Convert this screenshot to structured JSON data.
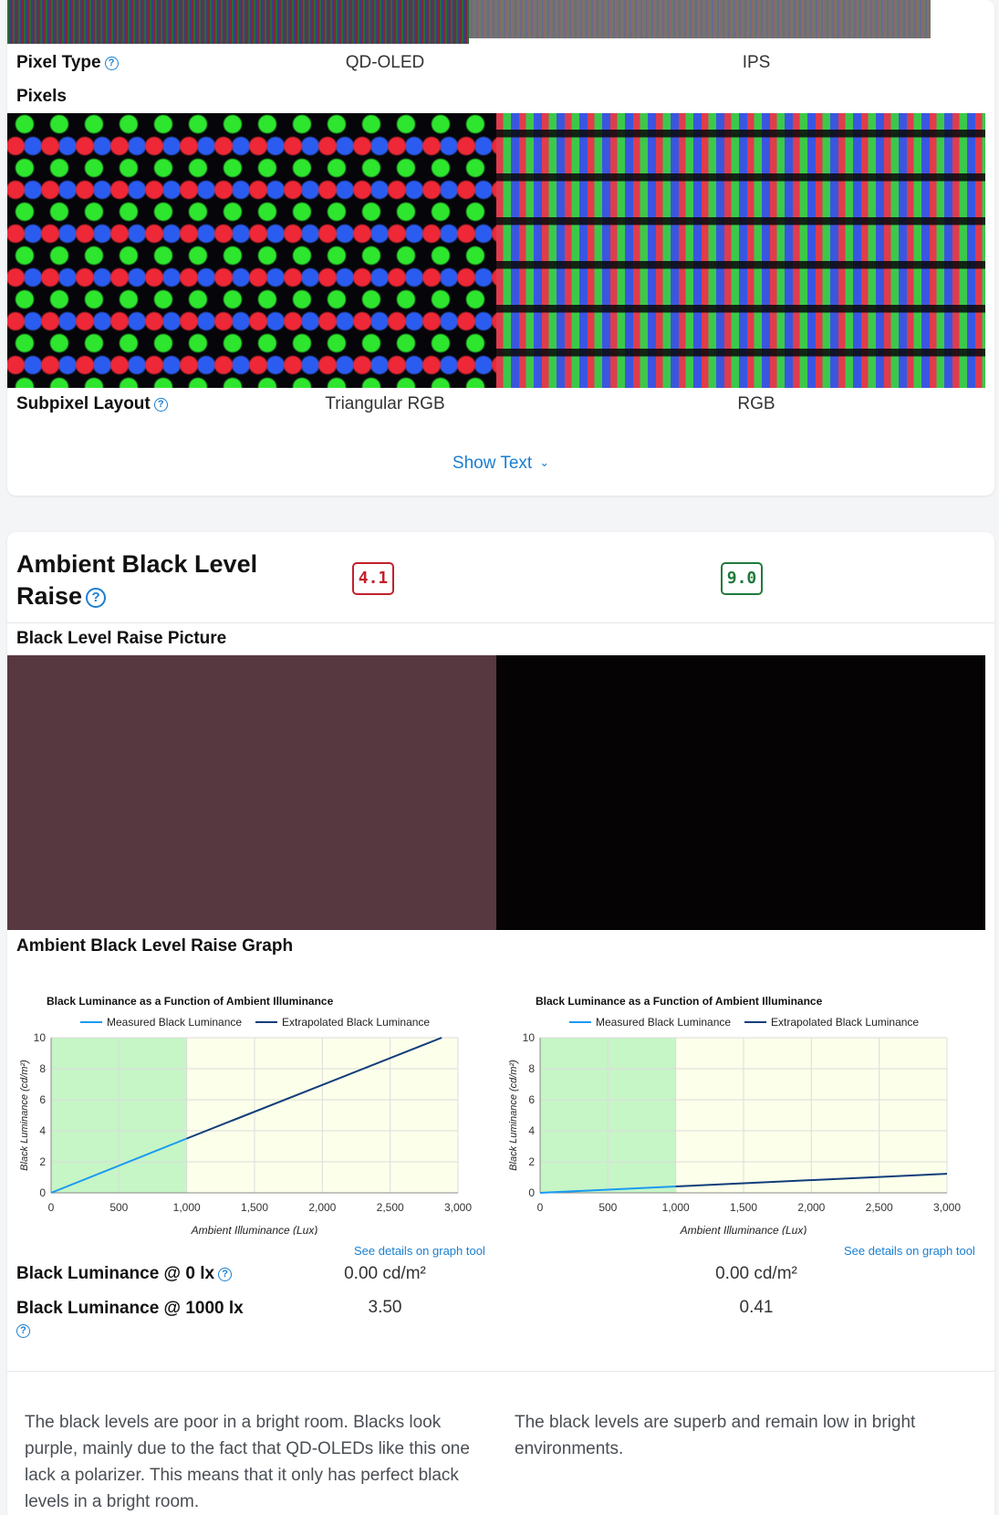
{
  "pixels_section": {
    "pixel_type": {
      "label": "Pixel Type",
      "left": "QD-OLED",
      "right": "IPS"
    },
    "pixels_label": "Pixels",
    "subpixel_layout": {
      "label": "Subpixel Layout",
      "left": "Triangular RGB",
      "right": "RGB"
    },
    "show_text": "Show Text"
  },
  "ambient_section": {
    "title": "Ambient Black Level Raise",
    "score_left": "4.1",
    "score_right": "9.0",
    "colors": {
      "poor": "#c3202b",
      "good": "#1f7a3a",
      "link": "#1a7fd1"
    },
    "picture_label": "Black Level Raise Picture",
    "picture_colors": {
      "left": "#583840",
      "right": "#060304"
    },
    "graph_label": "Ambient Black Level Raise Graph",
    "graph_link": "See details on graph tool",
    "black_at_0": {
      "label": "Black Luminance @ 0 lx",
      "left": "0.00 cd/m²",
      "right": "0.00 cd/m²"
    },
    "black_at_1000": {
      "label": "Black Luminance @ 1000 lx",
      "left": "3.50",
      "right": "0.41"
    },
    "desc_left": "The black levels are poor in a bright room. Blacks look purple, mainly due to the fact that QD-OLEDs like this one lack a polarizer. This means that it only has perfect black levels in a bright room.",
    "desc_right": "The black levels are superb and remain low in bright environments."
  },
  "chart_data": [
    {
      "type": "line",
      "title": "Black Luminance as a Function of Ambient Illuminance",
      "xlabel": "Ambient Illuminance (Lux)",
      "ylabel": "Black Luminance (cd/m²)",
      "xlim": [
        0,
        3000
      ],
      "ylim": [
        0,
        10
      ],
      "xticks": [
        "0",
        "500",
        "1,000",
        "1,500",
        "2,000",
        "2,500",
        "3,000"
      ],
      "yticks": [
        "0",
        "2",
        "4",
        "6",
        "8",
        "10"
      ],
      "shaded_region": {
        "range": [
          0,
          1000
        ],
        "color": "#c6f5c6"
      },
      "plot_background": "#fcffea",
      "grid": true,
      "legend_position": "top-center",
      "series": [
        {
          "name": "Measured Black Luminance",
          "color": "#1a9af0",
          "x": [
            0,
            1000
          ],
          "y": [
            0,
            3.5
          ]
        },
        {
          "name": "Extrapolated Black Luminance",
          "color": "#103d7a",
          "x": [
            1000,
            2880
          ],
          "y": [
            3.5,
            10
          ]
        }
      ]
    },
    {
      "type": "line",
      "title": "Black Luminance as a Function of Ambient Illuminance",
      "xlabel": "Ambient Illuminance (Lux)",
      "ylabel": "Black Luminance (cd/m²)",
      "xlim": [
        0,
        3000
      ],
      "ylim": [
        0,
        10
      ],
      "xticks": [
        "0",
        "500",
        "1,000",
        "1,500",
        "2,000",
        "2,500",
        "3,000"
      ],
      "yticks": [
        "0",
        "2",
        "4",
        "6",
        "8",
        "10"
      ],
      "shaded_region": {
        "range": [
          0,
          1000
        ],
        "color": "#c6f5c6"
      },
      "plot_background": "#fcffea",
      "grid": true,
      "legend_position": "top-center",
      "series": [
        {
          "name": "Measured Black Luminance",
          "color": "#1a9af0",
          "x": [
            0,
            1000
          ],
          "y": [
            0,
            0.41
          ]
        },
        {
          "name": "Extrapolated Black Luminance",
          "color": "#103d7a",
          "x": [
            1000,
            3000
          ],
          "y": [
            0.41,
            1.23
          ]
        }
      ]
    }
  ]
}
